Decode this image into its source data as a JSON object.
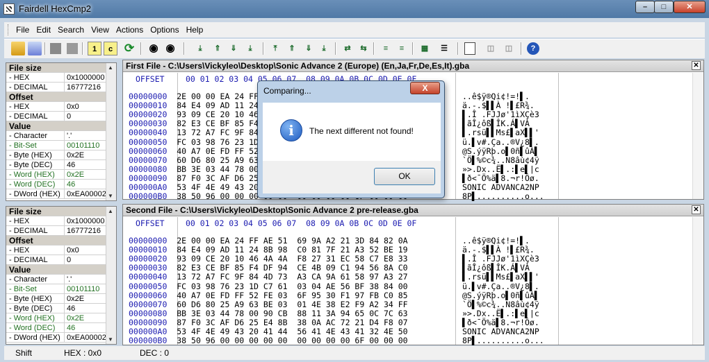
{
  "window": {
    "title": "Fairdell HexCmp2"
  },
  "menu": [
    "File",
    "Edit",
    "Search",
    "View",
    "Actions",
    "Options",
    "Help"
  ],
  "toolbar": {
    "icons": [
      "open-icon",
      "open2-icon",
      "stop-icon",
      "stop2-icon",
      "info1-icon",
      "info2-icon",
      "refresh-icon",
      "find-icon",
      "find-next-icon",
      "first-diff-icon",
      "prev-diff-icon",
      "next-diff-icon",
      "last-diff-icon",
      "first2-icon",
      "prev2-icon",
      "next2-icon",
      "last2-icon",
      "sync-icon",
      "sync2-icon",
      "align-icon",
      "align2-icon",
      "compare-icon",
      "list-icon",
      "report-icon",
      "copy-icon",
      "paste-icon",
      "help-icon"
    ],
    "labels": {
      "info1": "1",
      "info2": "c",
      "help": "?"
    }
  },
  "info_panels": [
    {
      "rows": [
        {
          "type": "hdr",
          "k": "File size",
          "v": ""
        },
        {
          "type": "row",
          "k": " - HEX",
          "v": "0x1000000"
        },
        {
          "type": "row",
          "k": " - DECIMAL",
          "v": "16777216"
        },
        {
          "type": "hdr",
          "k": "Offset",
          "v": ""
        },
        {
          "type": "row",
          "k": " - HEX",
          "v": "0x0"
        },
        {
          "type": "row",
          "k": " - DECIMAL",
          "v": "0"
        },
        {
          "type": "hdr",
          "k": "Value",
          "v": ""
        },
        {
          "type": "row",
          "k": " - Character",
          "v": "'.'"
        },
        {
          "type": "green",
          "k": " - Bit-Set",
          "v": "00101110"
        },
        {
          "type": "row",
          "k": " - Byte (HEX)",
          "v": "0x2E"
        },
        {
          "type": "row",
          "k": " - Byte (DEC)",
          "v": "46"
        },
        {
          "type": "green",
          "k": " - Word (HEX)",
          "v": "0x2E"
        },
        {
          "type": "green",
          "k": " - Word (DEC)",
          "v": "46"
        },
        {
          "type": "row",
          "k": " - DWord (HEX)",
          "v": "0xEA00002"
        }
      ]
    },
    {
      "rows": [
        {
          "type": "hdr",
          "k": "File size",
          "v": ""
        },
        {
          "type": "row",
          "k": " - HEX",
          "v": "0x1000000"
        },
        {
          "type": "row",
          "k": " - DECIMAL",
          "v": "16777216"
        },
        {
          "type": "hdr",
          "k": "Offset",
          "v": ""
        },
        {
          "type": "row",
          "k": " - HEX",
          "v": "0x0"
        },
        {
          "type": "row",
          "k": " - DECIMAL",
          "v": "0"
        },
        {
          "type": "hdr",
          "k": "Value",
          "v": ""
        },
        {
          "type": "row",
          "k": " - Character",
          "v": "'.'"
        },
        {
          "type": "green",
          "k": " - Bit-Set",
          "v": "00101110"
        },
        {
          "type": "row",
          "k": " - Byte (HEX)",
          "v": "0x2E"
        },
        {
          "type": "row",
          "k": " - Byte (DEC)",
          "v": "46"
        },
        {
          "type": "green",
          "k": " - Word (HEX)",
          "v": "0x2E"
        },
        {
          "type": "green",
          "k": " - Word (DEC)",
          "v": "46"
        },
        {
          "type": "row",
          "k": " - DWord (HEX)",
          "v": "0xEA00002"
        }
      ]
    }
  ],
  "files": [
    {
      "title": "First File - C:\\Users\\Vickyleo\\Desktop\\Sonic Advance 2 (Europe) (En,Ja,Fr,De,Es,It).gba",
      "offset_label": "OFFSET",
      "col_header": "00 01 02 03 04 05 06 07  08 09 0A 0B 0C 0D 0E 0F",
      "offsets": [
        "00000000",
        "00000010",
        "00000020",
        "00000030",
        "00000040",
        "00000050",
        "00000060",
        "00000070",
        "00000080",
        "00000090",
        "000000A0",
        "000000B0"
      ],
      "hex": [
        "2E 00 00 EA 24 FF AE 51  69 9A A2 21 3D 84 82 0A",
        "84 E4 09 AD 11 24 8B 98  C0 81 7F 21 A3 52 BE 19",
        "93 09 CE 20 10 46 4A 4A  F8 27 31 EC 58 C7 E8 33",
        "82 E3 CE BF 85 F4 DF 94  CE 4B 09 C1 94 56 8A C0",
        "13 72 A7 FC 9F 84 4D 73  A3 CA 9A 61 58 97 A3 27",
        "FC 03 98 76 23 1D C7 61  03 04 AE 56 BF 38 84 00",
        "40 A7 0E FD FF 52 FE 03  6F 95 30 F1 97 FB C0 85",
        "60 D6 80 25 A9 63 BE 03  01 4E 38 E2 F9 A2 34 FF",
        "BB 3E 03 44 78 00 90 CB  88 11 3A 94 65 0C 7C 63",
        "87 F0 3C AF D6 25 E4 8B  38 0A AC 72 21 D4 F8 07",
        "53 4F 4E 49 43 20 41 44  56 41 4E 43 41 32 4E 50",
        "38 50 96 00 00 00 00 00  00 00 00 00 6F 00 00 00"
      ],
      "ascii": [
        "..ê$ÿ®Qi¢!=!▌.",
        "ä.-.$▌▌À !▌£R¾.",
        "▌.Î .FJJø'1ìXÇè3",
        "▌ãÎ¿ôß▌ÎK.Á▌VÀ",
        "▌.rsü▌▌Ms£▌aX▌▌'",
        "ü.▌v#.Ça..®V¿8▌.",
        "@S.ýÿRþ.o▌0ñ▌ûÀ▌",
        "`Ö▌%©c¾..N8âù¢4ÿ",
        "»>.Dx..Ë▌.:▌e▌|c",
        "▌ð<¯Ö%ä▌8.¬r!Ôø.",
        "SONIC ADVANCA2NP",
        "8P▌..........o..."
      ]
    },
    {
      "title": "Second File - C:\\Users\\Vickyleo\\Desktop\\Sonic Advance 2 pre-release.gba",
      "offset_label": "OFFSET",
      "col_header": "00 01 02 03 04 05 06 07  08 09 0A 0B 0C 0D 0E 0F",
      "offsets": [
        "00000000",
        "00000010",
        "00000020",
        "00000030",
        "00000040",
        "00000050",
        "00000060",
        "00000070",
        "00000080",
        "00000090",
        "000000A0",
        "000000B0"
      ],
      "hex": [
        "2E 00 00 EA 24 FF AE 51  69 9A A2 21 3D 84 82 0A",
        "84 E4 09 AD 11 24 8B 98  C0 81 7F 21 A3 52 BE 19",
        "93 09 CE 20 10 46 4A 4A  F8 27 31 EC 58 C7 E8 33",
        "82 E3 CE BF 85 F4 DF 94  CE 4B 09 C1 94 56 8A C0",
        "13 72 A7 FC 9F 84 4D 73  A3 CA 9A 61 58 97 A3 27",
        "FC 03 98 76 23 1D C7 61  03 04 AE 56 BF 38 84 00",
        "40 A7 0E FD FF 52 FE 03  6F 95 30 F1 97 FB C0 85",
        "60 D6 80 25 A9 63 BE 03  01 4E 38 E2 F9 A2 34 FF",
        "BB 3E 03 44 78 00 90 CB  88 11 3A 94 65 0C 7C 63",
        "87 F0 3C AF D6 25 E4 8B  38 0A AC 72 21 D4 F8 07",
        "53 4F 4E 49 43 20 41 44  56 41 4E 43 41 32 4E 50",
        "38 50 96 00 00 00 00 00  00 00 00 00 6F 00 00 00"
      ],
      "ascii": [
        "..ê$ÿ®Qi¢!=!▌.",
        "ä.-.$▌▌À !▌£R¾.",
        "▌.Î .FJJø'1ìXÇè3",
        "▌ãÎ¿ôß▌ÎK.Á▌VÀ",
        "▌.rsü▌▌Ms£▌aX▌▌'",
        "ü.▌v#.Ça..®V¿8▌.",
        "@S.ýÿRþ.o▌0ñ▌ûÀ▌",
        "`Ö▌%©c¾..N8âù¢4ÿ",
        "»>.Dx..Ë▌.:▌e▌|c",
        "▌ð<¯Ö%ä▌8.¬r!Ôø.",
        "SONIC ADVANCA2NP",
        "8P▌..........o..."
      ]
    }
  ],
  "status": {
    "shift": "Shift",
    "hex": "HEX : 0x0",
    "dec": "DEC : 0"
  },
  "dialog": {
    "title": "Comparing...",
    "close": "X",
    "message": "The next different not found!",
    "ok": "OK",
    "icon_letter": "i"
  }
}
